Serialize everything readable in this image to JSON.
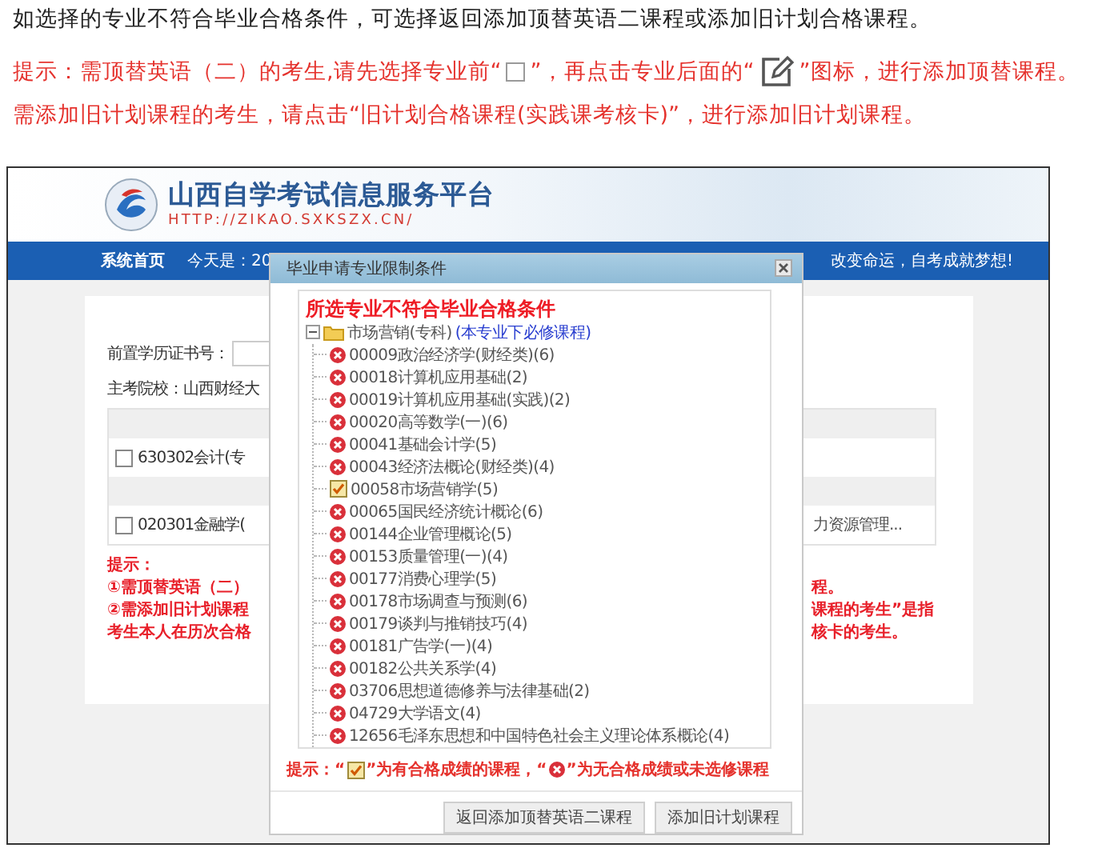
{
  "intro": {
    "text": "如选择的专业不符合毕业合格条件，可选择返回添加顶替英语二课程或添加旧计划合格课程。"
  },
  "tip_lines": [
    {
      "parts": [
        {
          "kind": "text",
          "text": "提示：需顶替英语（二）的考生,请先选择专业前“"
        },
        {
          "kind": "checkbox"
        },
        {
          "kind": "text",
          "text": "”，再点击专业后面的“"
        },
        {
          "kind": "edit"
        },
        {
          "kind": "text",
          "text": "”图标，进行添加顶替课程。"
        }
      ]
    },
    {
      "parts": [
        {
          "kind": "text",
          "text": "需添加旧计划课程的考生，请点击“旧计划合格课程(实践课考核卡)”，进行添加旧计划课程。"
        }
      ]
    }
  ],
  "screenshot": {
    "site_title": "山西自学考试信息服务平台",
    "site_url": "HTTP://ZIKAO.SXKSZX.CN/",
    "nav": {
      "home": "系统首页",
      "date": "今天是：20",
      "slogan": "改变命运，自考成就梦想!"
    },
    "form": {
      "cert_label": "前置学历证书号：",
      "school": "主考院校：山西财经大"
    },
    "majors": [
      {
        "checked": false,
        "cell_1": "630302会计(专"
      },
      {
        "checked": false,
        "cell_1": "020301金融学(",
        "cell_2": "力资源管理..."
      }
    ],
    "notes": [
      {
        "left": "提示："
      },
      {
        "left": "①需顶替英语（二）",
        "right": "程。"
      },
      {
        "left": "②需添加旧计划课程",
        "right": "课程的考生”是指"
      },
      {
        "left": "考生本人在历次合格",
        "right": "核卡的考生。"
      }
    ]
  },
  "dialog": {
    "title": "毕业申请专业限制条件",
    "heading": "所选专业不符合毕业合格条件",
    "tree": {
      "label": "市场营销(专科)",
      "note": "(本专业下必修课程)",
      "expanded": true,
      "children": [
        {
          "kind": "fail",
          "label": "00009政治经济学(财经类)(6)"
        },
        {
          "kind": "fail",
          "label": "00018计算机应用基础(2)"
        },
        {
          "kind": "fail",
          "label": "00019计算机应用基础(实践)(2)"
        },
        {
          "kind": "fail",
          "label": "00020高等数学(一)(6)"
        },
        {
          "kind": "fail",
          "label": "00041基础会计学(5)"
        },
        {
          "kind": "fail",
          "label": "00043经济法概论(财经类)(4)"
        },
        {
          "kind": "pass",
          "label": "00058市场营销学(5)"
        },
        {
          "kind": "fail",
          "label": "00065国民经济统计概论(6)"
        },
        {
          "kind": "fail",
          "label": "00144企业管理概论(5)"
        },
        {
          "kind": "fail",
          "label": "00153质量管理(一)(4)"
        },
        {
          "kind": "fail",
          "label": "00177消费心理学(5)"
        },
        {
          "kind": "fail",
          "label": "00178市场调查与预测(6)"
        },
        {
          "kind": "fail",
          "label": "00179谈判与推销技巧(4)"
        },
        {
          "kind": "fail",
          "label": "00181广告学(一)(4)"
        },
        {
          "kind": "fail",
          "label": "00182公共关系学(4)"
        },
        {
          "kind": "fail",
          "label": "03706思想道德修养与法律基础(2)"
        },
        {
          "kind": "fail",
          "label": "04729大学语文(4)"
        },
        {
          "kind": "fail",
          "label": "12656毛泽东思想和中国特色社会主义理论体系概论(4)"
        }
      ]
    },
    "legend": [
      {
        "kind": "text",
        "text": "提示：“"
      },
      {
        "kind": "pass"
      },
      {
        "kind": "text",
        "text": "”为有合格成绩的课程，“"
      },
      {
        "kind": "fail"
      },
      {
        "kind": "text",
        "text": "”为无合格成绩或未选修课程"
      }
    ],
    "buttons": [
      "返回添加顶替英语二课程",
      "添加旧计划课程"
    ]
  }
}
